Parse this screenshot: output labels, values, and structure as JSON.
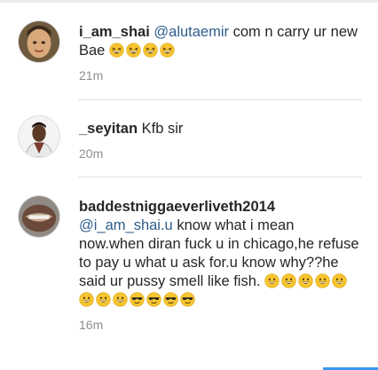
{
  "comments": [
    {
      "username": "i_am_shai",
      "mention": "@alutaemir",
      "text": " com n carry ur new Bae",
      "emojis": [
        "grinning-squint",
        "grinning-squint",
        "grinning-squint",
        "grinning-squint"
      ],
      "time": "21m"
    },
    {
      "username": "_seyitan",
      "text": " Kfb sir",
      "time": "20m"
    },
    {
      "username": "baddestniggaeverliveth2014",
      "mention": "@i_am_shai.u",
      "text": " know what i mean now.when diran fuck u in chicago,he refuse to pay u what u ask for.u know why??he said ur pussy smell like fish.",
      "emojis": [
        "grin",
        "grin",
        "grin",
        "grin",
        "grin",
        "grin",
        "grin",
        "grin",
        "sunglasses",
        "sunglasses",
        "sunglasses",
        "sunglasses"
      ],
      "time": "16m"
    }
  ],
  "colors": {
    "mention": "#2f5d8c",
    "timestamp": "#8e8e8e",
    "accent": "#3897f0"
  }
}
